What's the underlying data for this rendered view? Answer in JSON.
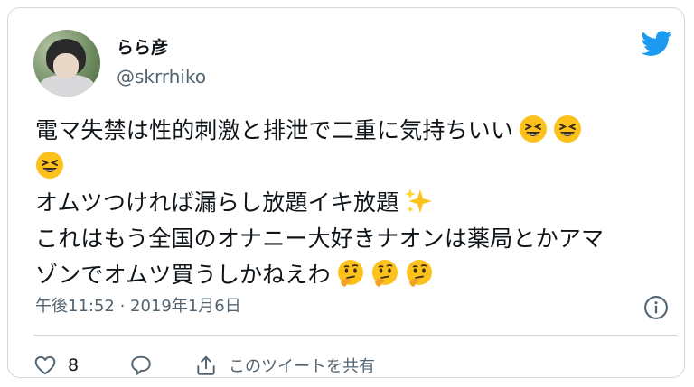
{
  "user": {
    "display_name": "らら彦",
    "handle": "@skrrhiko",
    "avatar_icon": "profile-avatar"
  },
  "brand": {
    "icon": "twitter-bird-icon",
    "color": "#1d9bf0"
  },
  "tweet": {
    "lines": [
      "電マ失禁は性的刺激と排泄で二重に気持ちいい",
      "オムツつければ漏らし放題イキ放題",
      "これはもう全国のオナニー大好きナオンは薬局とかアマ",
      "ゾンでオムツ買うしかねえわ"
    ]
  },
  "meta": {
    "timestamp": "午後11:52 · 2019年1月6日",
    "info_icon": "info-icon"
  },
  "actions": {
    "like_count": "8",
    "like_icon": "heart-icon",
    "reply_icon": "reply-icon",
    "share_icon": "share-icon",
    "share_label": "このツイートを共有"
  }
}
